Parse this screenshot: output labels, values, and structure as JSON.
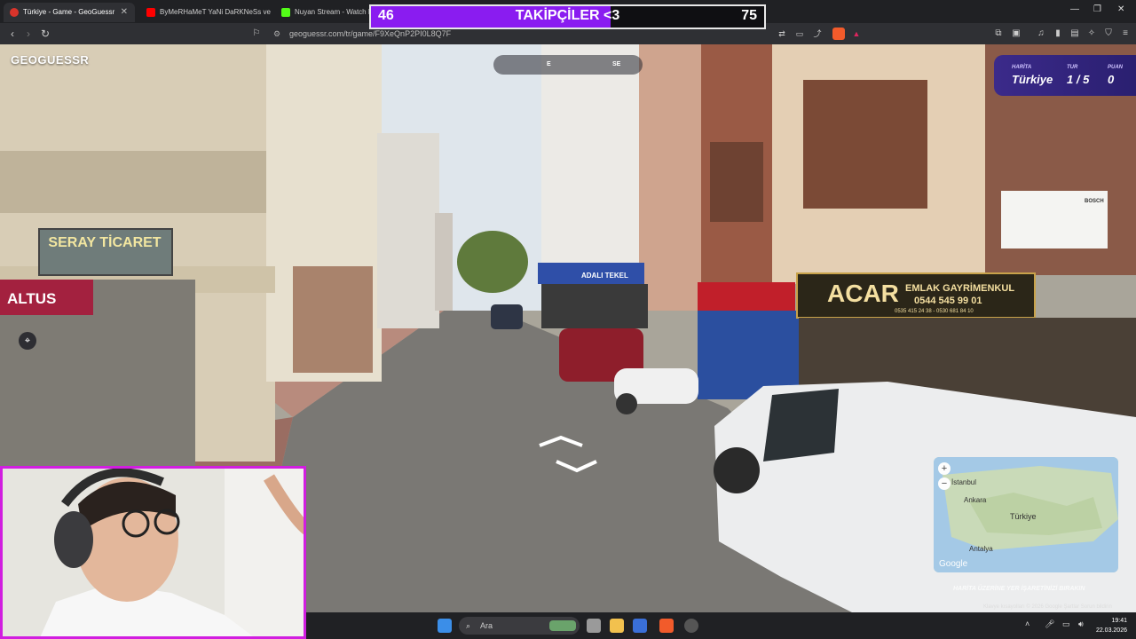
{
  "browser": {
    "tabs": [
      {
        "title": "Türkiye - Game - GeoGuessr",
        "active": true
      },
      {
        "title": "ByMeRHaMeT YaNi DaRKNeSs ve M",
        "active": false
      },
      {
        "title": "Nuyan Stream - Watch Li",
        "active": false
      }
    ],
    "url": "geoguessr.com/tr/game/F9XeQnP2PI0L8Q7F"
  },
  "overlay": {
    "left_count": "46",
    "title": "TAKİPÇİLER <3",
    "right_count": "75",
    "progress": 0.61,
    "color": "#8a1cf0"
  },
  "game": {
    "logo": "GEOGUESSR",
    "compass": {
      "e": "E",
      "se": "SE"
    },
    "status": {
      "map_label": "HARİTA",
      "map_value": "Türkiye",
      "round_label": "TUR",
      "round_value": "1 / 5",
      "score_label": "PUAN",
      "score_value": "0"
    },
    "minimap": {
      "places": {
        "istanbul": "İstanbul",
        "ankara": "Ankara",
        "turkiye": "Türkiye",
        "antalya": "Antalya"
      },
      "brand": "Google",
      "hint": "HARİTA ÜZERİNE YER İŞARETİNİZİ BIRAKIN",
      "footer": "Klavye kısayolları   © 2026 Google   Şartlar   Sorun bildirin"
    }
  },
  "scene_signs": {
    "seray": "SERAY TİCARET",
    "altus": "ALTUS",
    "acar": "ACAR",
    "acar_sub": "EMLAK GAYRİMENKUL",
    "acar_phone1": "0544 545 99 01",
    "acar_phone2": "0535 415 24 38 - 0530 681 84 10",
    "adali": "ADALI TEKEL",
    "bosch": "BOSCH"
  },
  "taskbar": {
    "search_placeholder": "Ara",
    "time": "19:41",
    "date": "22.03.2026"
  }
}
